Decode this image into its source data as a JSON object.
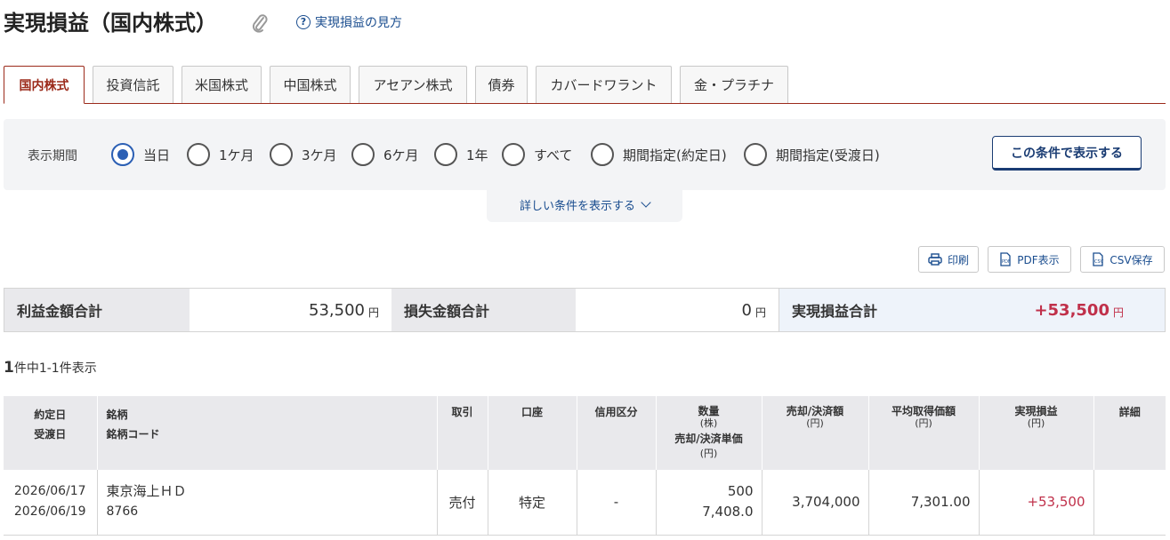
{
  "header": {
    "title": "実現損益（国内株式）",
    "help_link": "実現損益の見方"
  },
  "tabs": [
    {
      "label": "国内株式",
      "active": true
    },
    {
      "label": "投資信託",
      "active": false
    },
    {
      "label": "米国株式",
      "active": false
    },
    {
      "label": "中国株式",
      "active": false
    },
    {
      "label": "アセアン株式",
      "active": false
    },
    {
      "label": "債券",
      "active": false
    },
    {
      "label": "カバードワラント",
      "active": false
    },
    {
      "label": "金・プラチナ",
      "active": false
    }
  ],
  "filter": {
    "label": "表示期間",
    "options": [
      {
        "label": "当日",
        "checked": true
      },
      {
        "label": "1ケ月",
        "checked": false
      },
      {
        "label": "3ケ月",
        "checked": false
      },
      {
        "label": "6ケ月",
        "checked": false
      },
      {
        "label": "1年",
        "checked": false
      },
      {
        "label": "すべて",
        "checked": false
      },
      {
        "label": "期間指定(約定日)",
        "checked": false
      },
      {
        "label": "期間指定(受渡日)",
        "checked": false
      }
    ],
    "submit_label": "この条件で表示する",
    "more_label": "詳しい条件を表示する"
  },
  "actions": {
    "print": "印刷",
    "pdf": "PDF表示",
    "csv": "CSV保存"
  },
  "summary": {
    "profit_label": "利益金額合計",
    "profit_value": "53,500",
    "loss_label": "損失金額合計",
    "loss_value": "0",
    "total_label": "実現損益合計",
    "total_value": "+53,500",
    "yen": "円"
  },
  "count": {
    "number": "1",
    "text": "件中1-1件表示"
  },
  "table": {
    "headers": {
      "date1": "約定日",
      "date2": "受渡日",
      "name1": "銘柄",
      "name2": "銘柄コード",
      "trade": "取引",
      "account": "口座",
      "credit": "信用区分",
      "qty1": "数量",
      "qty_unit": "(株)",
      "qty2": "売却/決済単価",
      "qty2_unit": "(円)",
      "amount": "売却/決済額",
      "amount_unit": "(円)",
      "avg": "平均取得価額",
      "avg_unit": "(円)",
      "pl": "実現損益",
      "pl_unit": "(円)",
      "detail": "詳細"
    },
    "rows": [
      {
        "trade_date": "2026/06/17",
        "settle_date": "2026/06/19",
        "name": "東京海上ＨＤ",
        "code": "8766",
        "trade": "売付",
        "account": "特定",
        "credit": "-",
        "qty": "500",
        "price": "7,408.0",
        "amount": "3,704,000",
        "avg": "7,301.00",
        "pl": "+53,500",
        "detail": ""
      }
    ]
  },
  "colors": {
    "accent_red": "#9b2a1a",
    "profit_red": "#c0304a",
    "link_blue": "#1a4d8f"
  }
}
